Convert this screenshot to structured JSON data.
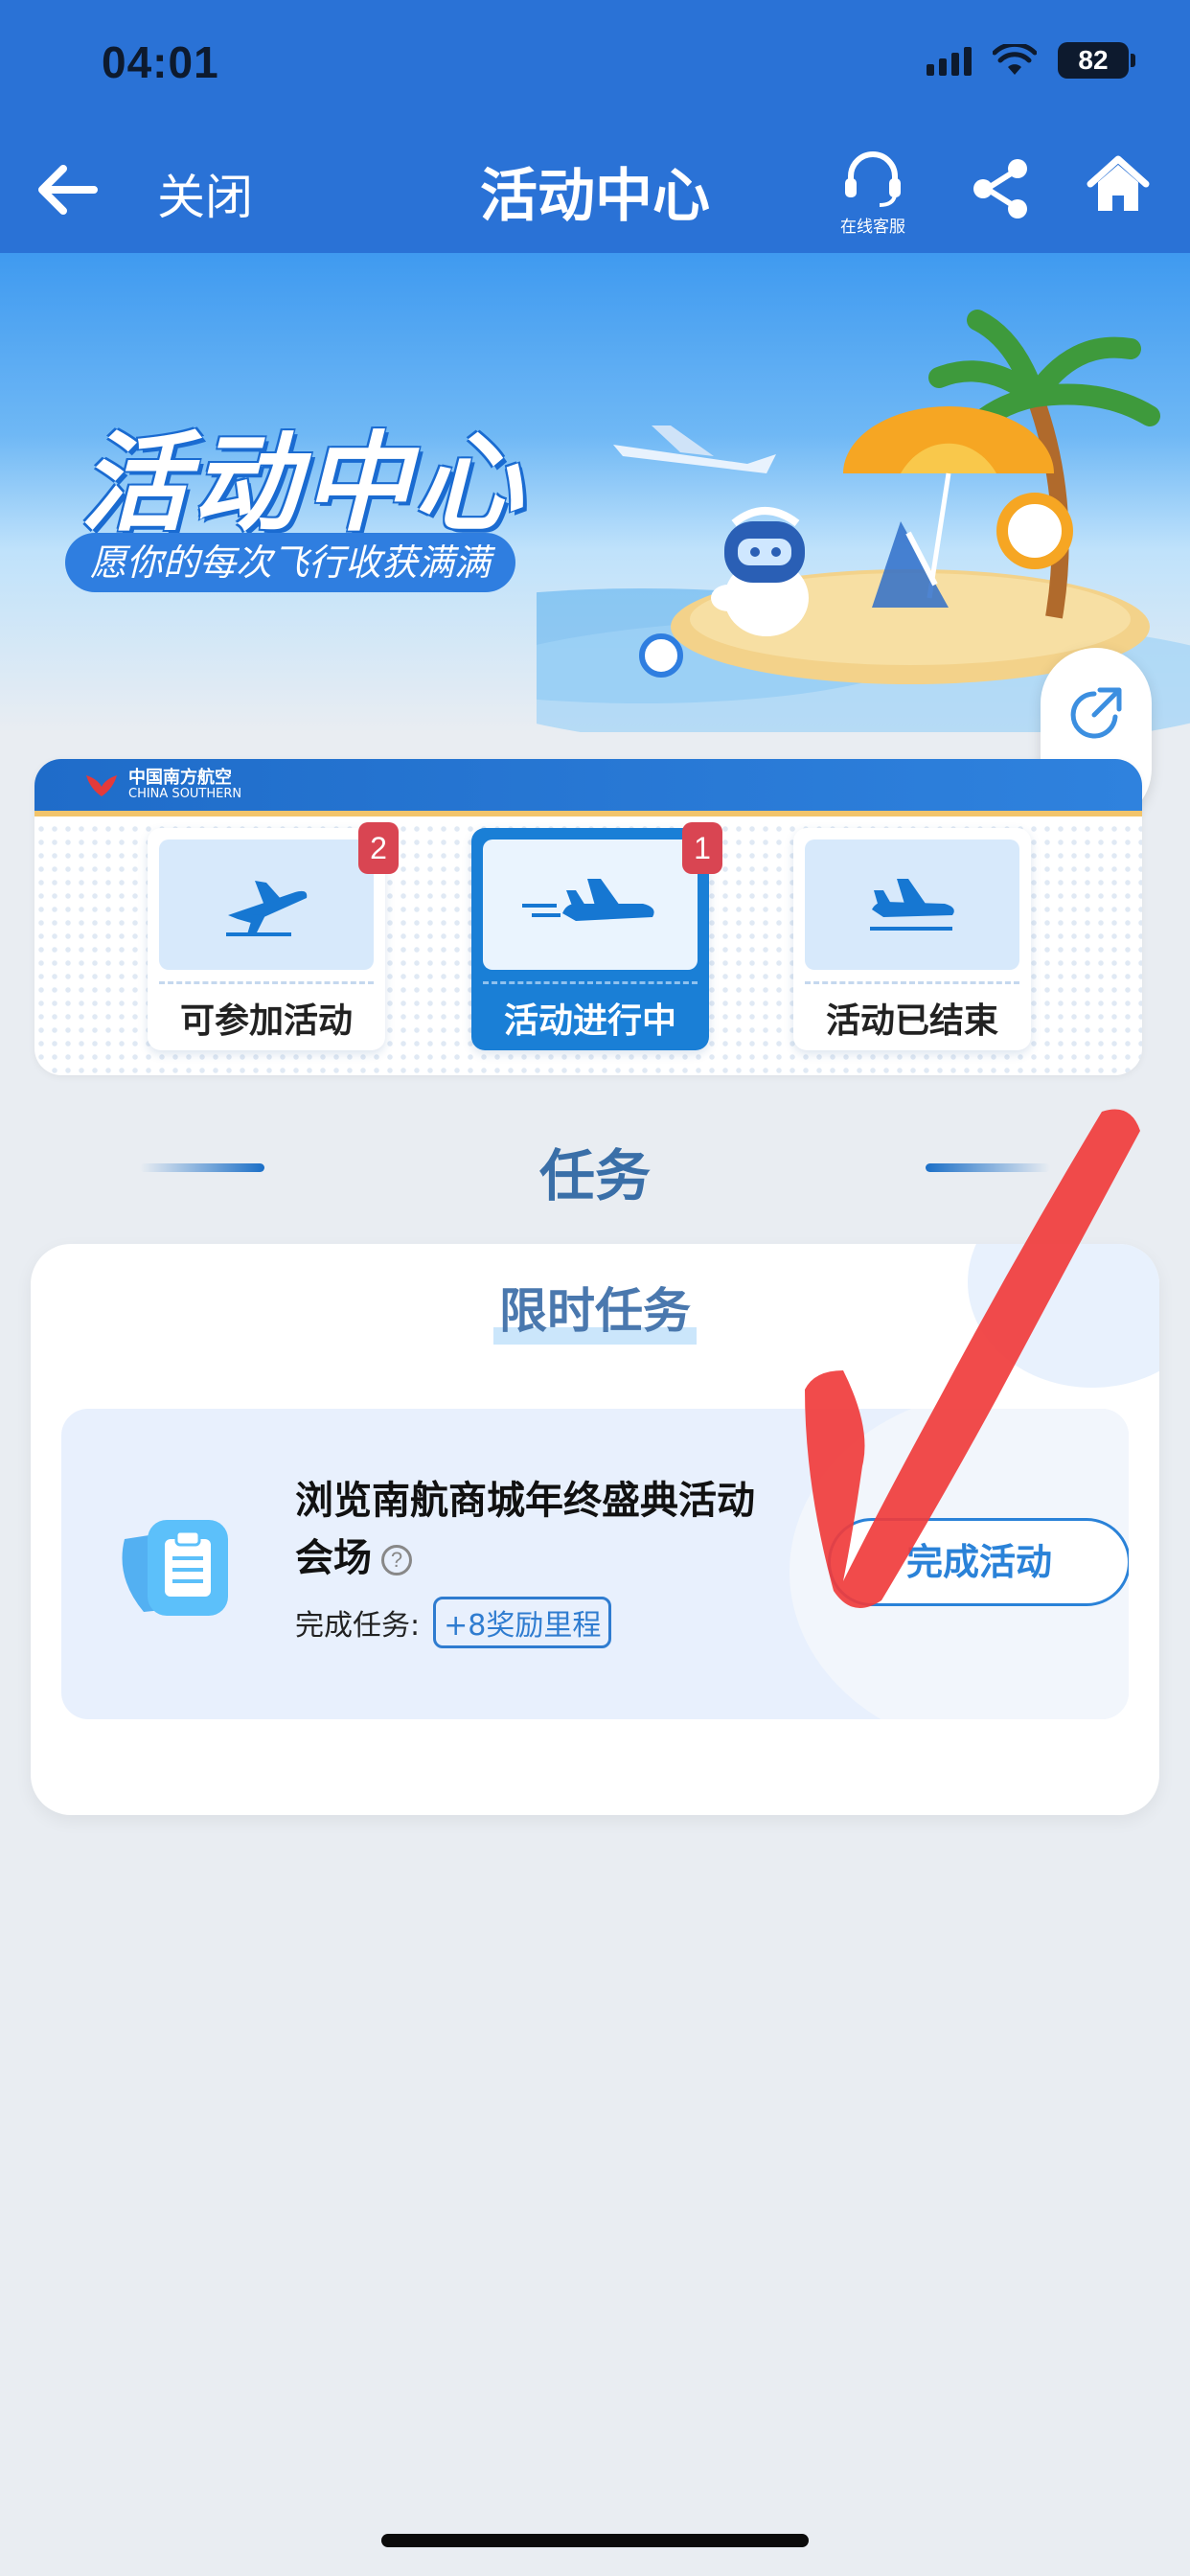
{
  "status_bar": {
    "time": "04:01",
    "battery": "82"
  },
  "nav": {
    "close_label": "关闭",
    "title": "活动中心",
    "support_label": "在线客服"
  },
  "banner": {
    "title": "活动中心",
    "subtitle": "愿你的每次飞行收获满满"
  },
  "float_share": {
    "label": "分享"
  },
  "airline": {
    "name_cn": "中国南方航空",
    "name_en": "CHINA SOUTHERN"
  },
  "tabs": [
    {
      "label": "可参加活动",
      "badge": "2",
      "active": false
    },
    {
      "label": "活动进行中",
      "badge": "1",
      "active": true
    },
    {
      "label": "活动已结束",
      "badge": "",
      "active": false
    }
  ],
  "section": {
    "title": "任务"
  },
  "task_card": {
    "heading": "限时任务",
    "task": {
      "title_line1": "浏览南航商城年终盛典活动",
      "title_line2": "会场",
      "help": "?",
      "reward_key": "完成任务:",
      "reward_value": "+8奖励里程",
      "button": "完成活动"
    }
  },
  "colors": {
    "nav_blue": "#2a72d6",
    "tab_active": "#1a7fd6",
    "badge_red": "#d94552",
    "page_bg": "#e9edf2",
    "annotation_red": "#f03c3c"
  },
  "icons": {
    "back": "arrow-left-icon",
    "support": "headset-icon",
    "share": "share-icon",
    "home": "home-icon",
    "float_share": "export-icon",
    "task": "clipboard-icon"
  }
}
